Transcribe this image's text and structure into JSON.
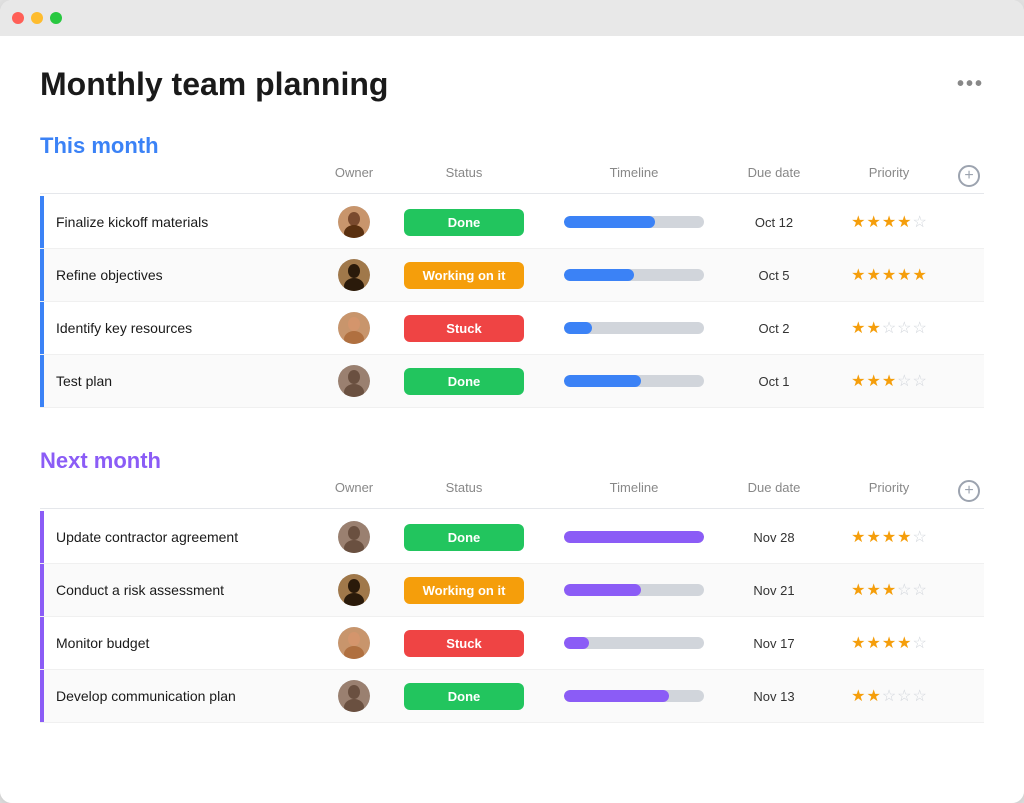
{
  "window": {
    "title": "Monthly team planning"
  },
  "header": {
    "title": "Monthly team planning",
    "more_icon": "•••"
  },
  "this_month": {
    "title": "This month",
    "columns": {
      "owner": "Owner",
      "status": "Status",
      "timeline": "Timeline",
      "due_date": "Due date",
      "priority": "Priority"
    },
    "rows": [
      {
        "task": "Finalize kickoff materials",
        "owner_id": 1,
        "status": "Done",
        "status_type": "done",
        "timeline_pct": 65,
        "due_date": "Oct 12",
        "stars": [
          true,
          true,
          true,
          true,
          false
        ]
      },
      {
        "task": "Refine objectives",
        "owner_id": 2,
        "status": "Working on it",
        "status_type": "working",
        "timeline_pct": 50,
        "due_date": "Oct 5",
        "stars": [
          true,
          true,
          true,
          true,
          true
        ]
      },
      {
        "task": "Identify key resources",
        "owner_id": 3,
        "status": "Stuck",
        "status_type": "stuck",
        "timeline_pct": 20,
        "due_date": "Oct 2",
        "stars": [
          true,
          true,
          false,
          false,
          false
        ]
      },
      {
        "task": "Test plan",
        "owner_id": 4,
        "status": "Done",
        "status_type": "done",
        "timeline_pct": 55,
        "due_date": "Oct 1",
        "stars": [
          true,
          true,
          true,
          false,
          false
        ]
      }
    ]
  },
  "next_month": {
    "title": "Next month",
    "columns": {
      "owner": "Owner",
      "status": "Status",
      "timeline": "Timeline",
      "due_date": "Due date",
      "priority": "Priority"
    },
    "rows": [
      {
        "task": "Update contractor agreement",
        "owner_id": 4,
        "status": "Done",
        "status_type": "done",
        "timeline_pct": 100,
        "due_date": "Nov 28",
        "stars": [
          true,
          true,
          true,
          true,
          false
        ]
      },
      {
        "task": "Conduct a risk assessment",
        "owner_id": 2,
        "status": "Working on it",
        "status_type": "working",
        "timeline_pct": 55,
        "due_date": "Nov 21",
        "stars": [
          true,
          true,
          true,
          false,
          false
        ]
      },
      {
        "task": "Monitor budget",
        "owner_id": 3,
        "status": "Stuck",
        "status_type": "stuck",
        "timeline_pct": 18,
        "due_date": "Nov 17",
        "stars": [
          true,
          true,
          true,
          true,
          false
        ]
      },
      {
        "task": "Develop communication plan",
        "owner_id": 4,
        "status": "Done",
        "status_type": "done",
        "timeline_pct": 75,
        "due_date": "Nov 13",
        "stars": [
          true,
          true,
          false,
          false,
          false
        ]
      }
    ]
  }
}
